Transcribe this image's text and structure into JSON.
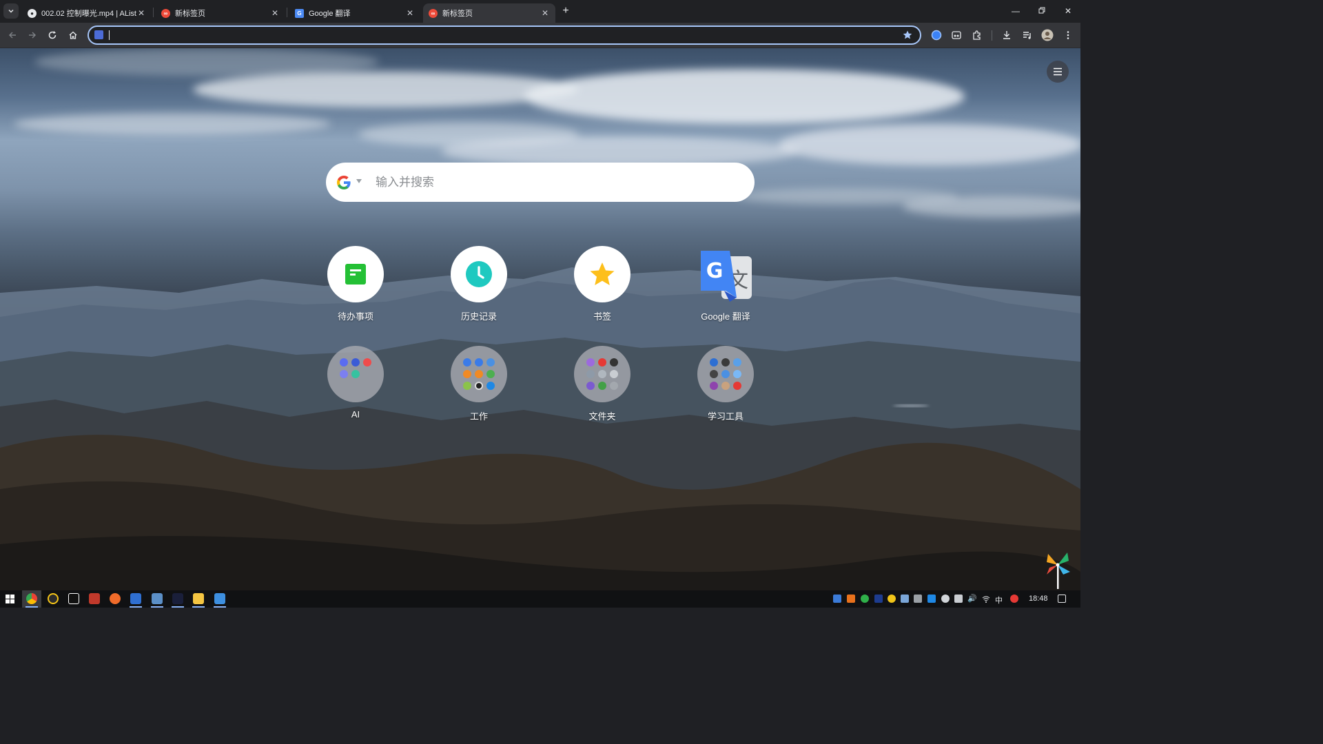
{
  "browser": {
    "tabs": [
      {
        "title": "002.02 控制曝光.mp4 | AList",
        "active": false
      },
      {
        "title": "新标签页",
        "active": false
      },
      {
        "title": "Google 翻译",
        "active": false
      },
      {
        "title": "新标签页",
        "active": true
      }
    ],
    "omnibox": {
      "value": "",
      "placeholder": ""
    },
    "accent": "#a8c7fa"
  },
  "newtab": {
    "search": {
      "placeholder": "输入并搜索",
      "engine_icon": "google-g-icon"
    },
    "shortcuts_row1": [
      {
        "label": "待办事项",
        "icon": "todo-icon",
        "color": "#24c035"
      },
      {
        "label": "历史记录",
        "icon": "clock-icon",
        "color": "#1fc9c0"
      },
      {
        "label": "书签",
        "icon": "star-icon",
        "color": "#fdbf1b"
      },
      {
        "label": "Google 翻译",
        "icon": "google-translate-icon",
        "color": "#4285f4"
      }
    ],
    "folders": [
      {
        "label": "AI"
      },
      {
        "label": "工作"
      },
      {
        "label": "文件夹"
      },
      {
        "label": "学习工具"
      }
    ]
  },
  "taskbar": {
    "time": "18:48",
    "ime": "中"
  }
}
